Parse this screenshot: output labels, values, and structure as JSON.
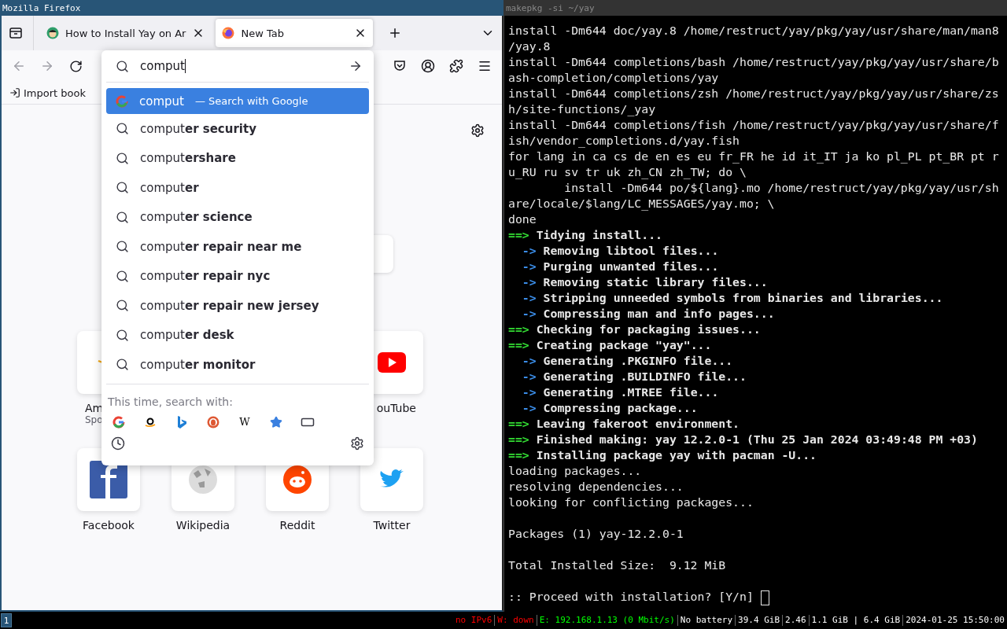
{
  "browser": {
    "title": "Mozilla Firefox",
    "tabs": [
      {
        "label": "How to Install Yay on Ar",
        "kind": "site",
        "selected": false
      },
      {
        "label": "New Tab",
        "kind": "firefox",
        "selected": true
      }
    ],
    "nav": {
      "back_disabled": true,
      "forward_disabled": true
    },
    "bookmarks_bar": {
      "import_label": "Import book"
    },
    "urlbar": {
      "value": "comput",
      "primary": {
        "query": "comput",
        "separator": "—",
        "action": "Search with Google"
      },
      "suggestions": [
        "comput**er security**",
        "comput**ershare**",
        "comput**er**",
        "comput**er science**",
        "comput**er repair near me**",
        "comput**er repair nyc**",
        "comput**er repair new jersey**",
        "comput**er desk**",
        "comput**er monitor**"
      ],
      "search_with_label": "This time, search with:",
      "engines": [
        {
          "kind": "google"
        },
        {
          "kind": "amazon"
        },
        {
          "kind": "bing"
        },
        {
          "kind": "duckduckgo"
        },
        {
          "kind": "wikipedia",
          "glyph": "W"
        },
        {
          "kind": "bookmarks"
        },
        {
          "kind": "tabs"
        }
      ]
    },
    "top_sites": [
      [
        {
          "kind": "amazon",
          "label": "Am",
          "sublabel": "Spo"
        },
        {
          "kind": "youtube",
          "label": "ouTube"
        }
      ],
      [
        {
          "kind": "facebook",
          "label": "Facebook"
        },
        {
          "kind": "wikipedia",
          "label": "Wikipedia"
        },
        {
          "kind": "reddit",
          "label": "Reddit"
        },
        {
          "kind": "twitter",
          "label": "Twitter"
        }
      ]
    ]
  },
  "terminal": {
    "title": "makepkg -si ~/yay",
    "lines": [
      {
        "kind": "plain",
        "text": "install -Dm644 doc/yay.8 /home/restruct/yay/pkg/yay/usr/share/man/man8"
      },
      {
        "kind": "plain",
        "text": "/yay.8"
      },
      {
        "kind": "plain",
        "text": "install -Dm644 completions/bash /home/restruct/yay/pkg/yay/usr/share/b"
      },
      {
        "kind": "plain",
        "text": "ash-completion/completions/yay"
      },
      {
        "kind": "plain",
        "text": "install -Dm644 completions/zsh /home/restruct/yay/pkg/yay/usr/share/zs"
      },
      {
        "kind": "plain",
        "text": "h/site-functions/_yay"
      },
      {
        "kind": "plain",
        "text": "install -Dm644 completions/fish /home/restruct/yay/pkg/yay/usr/share/f"
      },
      {
        "kind": "plain",
        "text": "ish/vendor_completions.d/yay.fish"
      },
      {
        "kind": "plain",
        "text": "for lang in ca cs de en es eu fr_FR he id it_IT ja ko pl_PL pt_BR pt r"
      },
      {
        "kind": "plain",
        "text": "u_RU ru sv tr uk zh_CN zh_TW; do \\"
      },
      {
        "kind": "plain",
        "text": "        install -Dm644 po/${lang}.mo /home/restruct/yay/pkg/yay/usr/sh"
      },
      {
        "kind": "plain",
        "text": "are/locale/$lang/LC_MESSAGES/yay.mo; \\"
      },
      {
        "kind": "plain",
        "text": "done"
      },
      {
        "kind": "step",
        "marker": "==>",
        "text": "Tidying install..."
      },
      {
        "kind": "substep",
        "marker": "->",
        "text": "Removing libtool files..."
      },
      {
        "kind": "substep",
        "marker": "->",
        "text": "Purging unwanted files..."
      },
      {
        "kind": "substep",
        "marker": "->",
        "text": "Removing static library files..."
      },
      {
        "kind": "substep",
        "marker": "->",
        "text": "Stripping unneeded symbols from binaries and libraries..."
      },
      {
        "kind": "substep",
        "marker": "->",
        "text": "Compressing man and info pages..."
      },
      {
        "kind": "step",
        "marker": "==>",
        "text": "Checking for packaging issues..."
      },
      {
        "kind": "step",
        "marker": "==>",
        "text": "Creating package \"yay\"..."
      },
      {
        "kind": "substep",
        "marker": "->",
        "text": "Generating .PKGINFO file..."
      },
      {
        "kind": "substep",
        "marker": "->",
        "text": "Generating .BUILDINFO file..."
      },
      {
        "kind": "substep",
        "marker": "->",
        "text": "Generating .MTREE file..."
      },
      {
        "kind": "substep",
        "marker": "->",
        "text": "Compressing package..."
      },
      {
        "kind": "step",
        "marker": "==>",
        "text": "Leaving fakeroot environment."
      },
      {
        "kind": "step",
        "marker": "==>",
        "text": "Finished making: yay 12.2.0-1 (Thu 25 Jan 2024 03:49:48 PM +03)"
      },
      {
        "kind": "step",
        "marker": "==>",
        "text": "Installing package yay with pacman -U..."
      },
      {
        "kind": "plain",
        "text": "loading packages..."
      },
      {
        "kind": "plain",
        "text": "resolving dependencies..."
      },
      {
        "kind": "plain",
        "text": "looking for conflicting packages..."
      },
      {
        "kind": "blank"
      },
      {
        "kind": "plain",
        "text": "Packages (1) yay-12.2.0-1"
      },
      {
        "kind": "blank"
      },
      {
        "kind": "plain",
        "text": "Total Installed Size:  9.12 MiB"
      },
      {
        "kind": "blank"
      },
      {
        "kind": "prompt",
        "text": ":: Proceed with installation? [Y/n]"
      }
    ]
  },
  "status_bar": {
    "workspaces": [
      {
        "label": "1",
        "selected": true
      }
    ],
    "items": [
      {
        "text": "no IPv6",
        "color": "#ff0000"
      },
      {
        "text": "W: down",
        "color": "#ff0000"
      },
      {
        "text": "E: 192.168.1.13 (0 Mbit/s)",
        "color": "#00ff00"
      },
      {
        "text": "No battery",
        "color": "#ffffff"
      },
      {
        "text": "39.4 GiB",
        "color": "#ffffff"
      },
      {
        "text": "2.46",
        "color": "#ffffff"
      },
      {
        "text": "1.1 GiB | 6.4 GiB",
        "color": "#ffffff"
      },
      {
        "text": "2024-01-25 15:50:00",
        "color": "#ffffff"
      }
    ]
  }
}
